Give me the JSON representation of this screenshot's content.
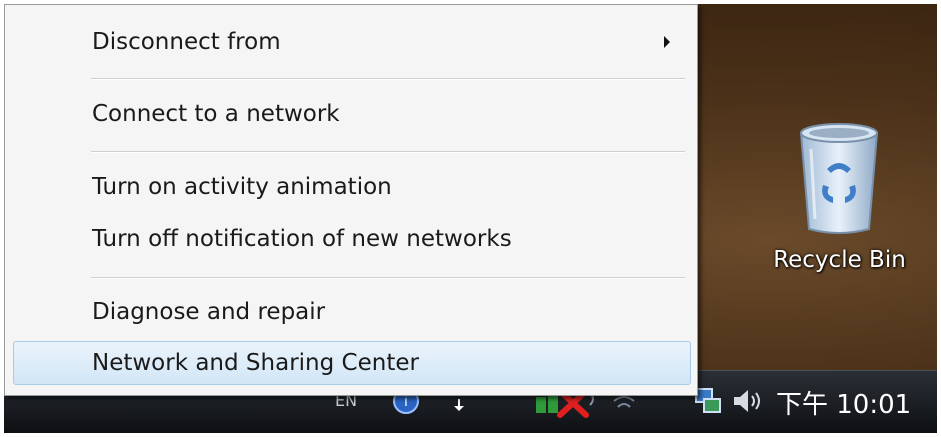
{
  "context_menu": {
    "items": [
      {
        "label": "Disconnect from",
        "has_submenu": true
      },
      {
        "label": "Connect to a network"
      },
      {
        "label": "Turn on activity animation"
      },
      {
        "label": "Turn off notification of new networks"
      },
      {
        "label": "Diagnose and repair"
      },
      {
        "label": "Network and Sharing Center",
        "highlighted": true
      }
    ]
  },
  "desktop": {
    "recycle_bin": {
      "label": "Recycle Bin",
      "icon": "recycle-bin-icon"
    }
  },
  "taskbar": {
    "language": "EN",
    "clock": "下午 10:01",
    "tray_icons": [
      "help-icon",
      "arrow-down-icon",
      "network-error-icon",
      "wireless-icon",
      "network-icon",
      "volume-icon"
    ]
  },
  "colors": {
    "menu_bg": "#f5f5f5",
    "highlight": "#d2e6f7",
    "taskbar": "#0d0f12",
    "desktop": "#4a3018"
  }
}
